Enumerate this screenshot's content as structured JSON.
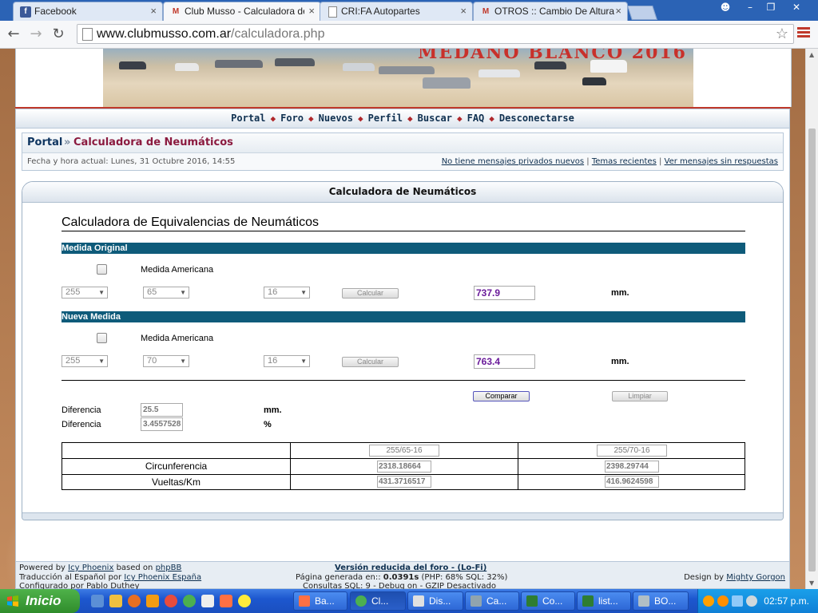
{
  "browser": {
    "tabs": [
      {
        "icon": "facebook-icon",
        "label": "Facebook",
        "active": false
      },
      {
        "icon": "club-musso-icon",
        "label": "Club Musso - Calculadora de",
        "active": true
      },
      {
        "icon": "page-icon",
        "label": "CRI:FA Autopartes",
        "active": false
      },
      {
        "icon": "club-musso-icon",
        "label": "OTROS :: Cambio De Altura",
        "active": false
      }
    ],
    "url_domain": "www.clubmusso.com.ar",
    "url_path": "/calculadora.php"
  },
  "site": {
    "banner_title": "MEDANO BLANCO 2016",
    "nav": [
      "Portal",
      "Foro",
      "Nuevos",
      "Perfil",
      "Buscar",
      "FAQ",
      "Desconectarse"
    ],
    "breadcrumb_home": "Portal",
    "breadcrumb_sep": "»",
    "breadcrumb_current": "Calculadora de Neumáticos",
    "datetime": "Fecha y hora actual: Lunes, 31 Octubre 2016, 14:55",
    "links": [
      "No tiene mensajes privados nuevos",
      "Temas recientes",
      "Ver mensajes sin respuestas"
    ],
    "link_sep": "|"
  },
  "calculator": {
    "box_title": "Calculadora de Neumáticos",
    "heading": "Calculadora de Equivalencias de Neumáticos",
    "original": {
      "section": "Medida Original",
      "american_label": "Medida Americana",
      "width": "255",
      "profile": "65",
      "rim": "16",
      "calc_label": "Calcular",
      "result": "737.9",
      "unit": "mm."
    },
    "new": {
      "section": "Nueva Medida",
      "american_label": "Medida Americana",
      "width": "255",
      "profile": "70",
      "rim": "16",
      "calc_label": "Calcular",
      "result": "763.4",
      "unit": "mm."
    },
    "compare_label": "Comparar",
    "clear_label": "Limpiar",
    "diff_label": "Diferencia",
    "diff_mm": "25.5",
    "diff_mm_unit": "mm.",
    "diff_pct": "3.4557528",
    "diff_pct_unit": "%",
    "table": {
      "size_a": "255/65-16",
      "size_b": "255/70-16",
      "rows": [
        {
          "label": "Circunferencia",
          "a": "2318.18664",
          "b": "2398.29744"
        },
        {
          "label": "Vueltas/Km",
          "a": "431.3716517",
          "b": "416.9624598"
        }
      ]
    }
  },
  "footer": {
    "powered_prefix": "Powered by",
    "powered_icy": "Icy Phoenix",
    "powered_mid": "based on",
    "powered_phpbb": "phpBB",
    "translation_prefix": "Traducción al Español por",
    "translation_link": "Icy Phoenix España",
    "configured": "Configurado por Pablo Duthey",
    "lofi": "Versión reducida del foro - (Lo-Fi)",
    "generated_prefix": "Página generada en::",
    "generated_time": "0.0391s",
    "generated_suffix": "(PHP: 68% SQL: 32%)",
    "queries": "Consultas SQL: 9 - Debug on - GZIP Desactivado",
    "design_prefix": "Design by",
    "design_link": "Mighty Gorgon"
  },
  "taskbar": {
    "start_label": "Inicio",
    "tasks": [
      "Ba...",
      "Cl...",
      "Dis...",
      "Ca...",
      "Co...",
      "list...",
      "BO..."
    ],
    "clock": "02:57 p.m."
  },
  "colors": {
    "chrome_blue": "#2b63b5",
    "nav_diamond": "#b0282b",
    "section_bar": "#0e5b7a",
    "result_text": "#6a1b9a",
    "taskbar_blue": "#1d57cf",
    "start_green": "#3a9a35"
  }
}
